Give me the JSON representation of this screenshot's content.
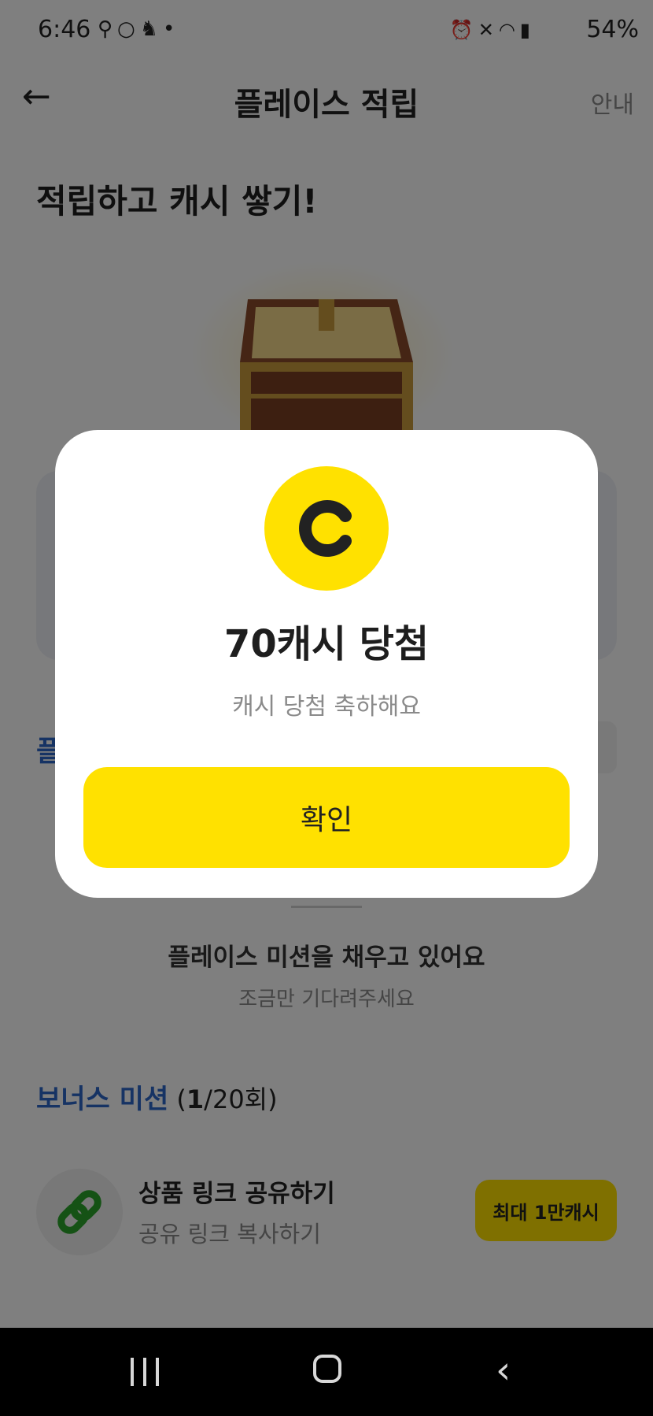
{
  "status_bar": {
    "time": "6:46",
    "left_icons": [
      "link-icon",
      "oo-icon",
      "rabbit-icon",
      "dot-icon"
    ],
    "right_icons": [
      "alarm-icon",
      "mute-icon",
      "wifi-icon",
      "hd-voice-icon",
      "signal-icon"
    ],
    "battery": "54%"
  },
  "header": {
    "title": "플레이스 적립",
    "guide": "안내"
  },
  "headline": "적립하고 캐시 쌓기!",
  "partial_label": "플",
  "mission": {
    "title": "플레이스 미션을 채우고 있어요",
    "subtitle": "조금만 기다려주세요"
  },
  "bonus": {
    "label": "보너스 미션",
    "open": " (",
    "current": "1",
    "rest": "/20회)"
  },
  "task": {
    "title": "상품 링크 공유하기",
    "subtitle": "공유 링크 복사하기",
    "button": "최대 1만캐시"
  },
  "modal": {
    "title": "70캐시 당첨",
    "subtitle": "캐시 당첨 축하해요",
    "confirm": "확인"
  },
  "colors": {
    "accent_yellow": "#ffe100",
    "link_blue": "#2c67c9",
    "link_icon_green": "#2aa52a"
  }
}
